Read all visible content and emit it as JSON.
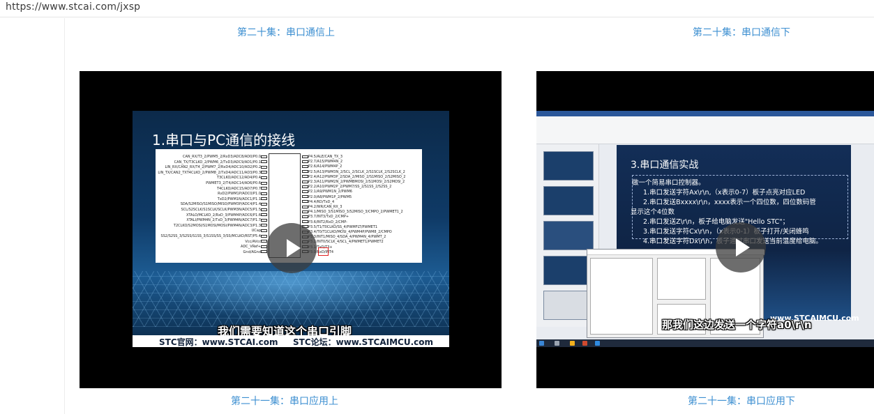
{
  "browser": {
    "url": "https://www.stcai.com/jxsp"
  },
  "episodes": [
    {
      "title": "第二十集：串口通信上"
    },
    {
      "title": "第二十集：串口通信下"
    },
    {
      "title": "第二十一集：串口应用上"
    },
    {
      "title": "第二十一集：串口应用下"
    }
  ],
  "video_left": {
    "slide_title": "1.串口与PC通信的接线",
    "subtitle": "我们需要知道这个串口引脚",
    "footer_left": "STC官网：www.STCAI.com",
    "footer_right": "STC论坛：www.STCAIMCU.com",
    "pins_left": [
      "CAN_RX/T3_2/PWM5_2/RxD3/ADC8/AD0/P0.0",
      "CAN_TX/T3CLKO_2/PWM6_2/TxD3/ADC9/AD1/P0.1",
      "LIN_RX/CAN2_RX/T4_2/PWM7_2/RxD4/ADC10/AD2/P0.2",
      "LIN_TX/CAN2_TXT4CLKO_2/PWM8_2/TxD4/ADC11/AD3/P0.3",
      "T3CLKO/ADC12/AD4/P0.4",
      "PWMET3_2/T4/ADC14/AD6/P0.6",
      "T4CLKO/ADC15/AD7/P0.7",
      "RxD2/PWM1P/ADC0/P1.0",
      "TxD2/PWM1N/ADC1/P1.1",
      "SDA/S2MISO/S1MISO/MISO/PWM3P/ADC4/P1.4",
      "SCL/S2SCLK/S1SCLK/SCLK/PWM3N/ADC5/P1.5",
      "XTALO/MCLKO_2/RxD_3/PWM4P/ADC6/P1.6",
      "XTALI/PWM4N_2/TxD_3/PWM4N/ADC7/P1.7",
      "T2CLKO/S2MOSI/S1MOSI/MOSI/PWM4N/ADC3/P1.3",
      "UCap",
      "SS2/S2SS_3/S2SS/S1SS_3/S1SS/SS_3/SS/MCLKO/RST/P5.4",
      "Vcc/AVcc",
      "ADC_VRef+",
      "Gnd/AGnd"
    ],
    "pins_right": [
      "P4.5/ALE/CAN_TX_3",
      "P2.7/A15/PWM4N_2",
      "P2.6/A14/PWM4P_2",
      "P2.5/A13/PWM3N_2/SCL_2/SCLK_2/S1SCLK_2/S2SCLK_2",
      "P2.4/A12/PWM3P_2/SDA_2/MISO_2/S1MISO_2/S2MISO_2",
      "P2.3/A11/PWM2N_2/PWMBMOSI_2/S1MOSI_2/S2MOSI_2",
      "P2.2/A10/PWM2P_2/PWM7/SS_2/S1SS_2/S2SS_2",
      "P2.1/A9/PWM1N_2/PWM6",
      "P2.0/A8/PWM1P_2/PWM5",
      "P4.4/RD/TxD_4",
      "P4.2/WR/CAN_RX_3",
      "P4.1/MISO_3/S1MISO_3/S2MISO_3/CMPO_2/PWMET1_2",
      "P3.7/INT3/TxD_2/CMP+",
      "P3.6/INT2/RxD_2/CMP-",
      "P3.5/T1/T0CLKO/SS_4/PWMFLT/PWMET1",
      "P3.4/T0/T1CLKO/MOSI_4/PWM4P/PWM8_2/CMPO",
      "P3.3/INT1/MISO_4/SDA_4/PWM4N_4/PWMT_2",
      "P3.2/INT0/SCLK_4/SCL_4/PWMET1/PWMET2",
      "P3.1/TxD/T3+",
      "P3.0/RxD/INT4"
    ]
  },
  "video_right": {
    "slide_title": "3.串口通信实战",
    "lines": [
      "做一个简易串口控制器。",
      "1.串口发送字符Ax\\r\\n,（x表示0-7）板子点亮对应LED",
      "2.串口发送Bxxxx\\r\\n，xxxx表示一个四位数，四位数码管",
      "显示这个4位数",
      "2.串口发送Z\\r\\n，板子给电脑发送\"Hello STC\"；",
      "3.串口发送字符Cx\\r\\n，（x表示0-1）板子打开/关闭蜂鸣",
      "4.串口发送字符Dx\\r\\n，板子通过串口发送当前温度给电脑。"
    ],
    "subtitle": "那我们这边发送一个字符a0\\r\\n",
    "watermark": "www.STCAIMCU.com"
  },
  "colors": {
    "link": "#3d8fd1",
    "player_bg": "#000000"
  }
}
